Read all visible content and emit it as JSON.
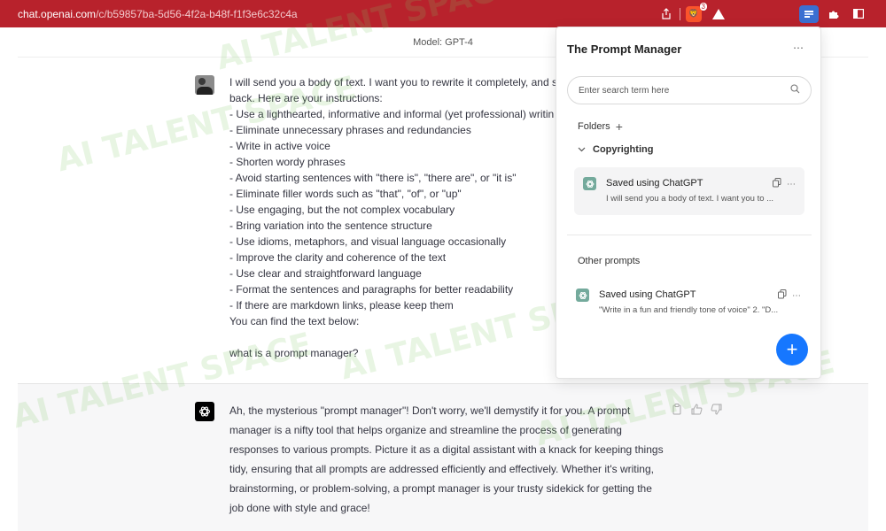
{
  "browser": {
    "url_host": "chat.openai.com",
    "url_path": "/c/b59857ba-5d56-4f2a-b48f-f1f3e6c32c4a",
    "brave_badge": "3",
    "colors": {
      "topbar": "#b8222c",
      "active_extension": "#3b6fd1"
    }
  },
  "header": {
    "model_label": "Model: GPT-4"
  },
  "user_message": {
    "text": "I will send you a body of text. I want you to rewrite it completely, and se\nback. Here are your instructions:\n- Use a lighthearted, informative and informal (yet professional) writin\n- Eliminate unnecessary phrases and redundancies\n- Write in active voice\n- Shorten wordy phrases\n- Avoid starting sentences with \"there is\", \"there are\", or \"it is\"\n- Eliminate filler words such as \"that\", \"of\", or \"up\"\n- Use engaging, but the not complex vocabulary\n- Bring variation into the sentence structure\n- Use idioms, metaphors, and visual language occasionally\n- Improve the clarity and coherence of the text\n- Use clear and straightforward language\n- Format the sentences and paragraphs for better readability\n- If there are markdown links, please keep them\nYou can find the text below:\n\nwhat is a prompt manager?"
  },
  "assistant_message": {
    "text": "Ah, the mysterious \"prompt manager\"! Don't worry, we'll demystify it for you. A prompt manager is a nifty tool that helps organize and streamline the process of generating responses to various prompts. Picture it as a digital assistant with a knack for keeping things tidy, ensuring that all prompts are addressed efficiently and effectively. Whether it's writing, brainstorming, or problem-solving, a prompt manager is your trusty sidekick for getting the job done with style and grace!"
  },
  "watermark": {
    "text": "AI TALENT SPACE"
  },
  "prompt_manager": {
    "title": "The Prompt Manager",
    "more_icon": "⋯",
    "search_placeholder": "Enter search term here",
    "folders_label": "Folders",
    "folder_name": "Copyrighting",
    "folder_prompts": [
      {
        "title": "Saved using ChatGPT",
        "preview": "I will send you a body of text. I want you to ..."
      }
    ],
    "other_prompts_label": "Other prompts",
    "other_prompts": [
      {
        "title": "Saved using ChatGPT",
        "preview": "\"Write in a fun and friendly tone of voice\" 2. \"D..."
      }
    ],
    "colors": {
      "fab": "#1677ff",
      "card_bg": "#f4f4f5",
      "chatgpt_icon": "#74aa9c"
    }
  }
}
